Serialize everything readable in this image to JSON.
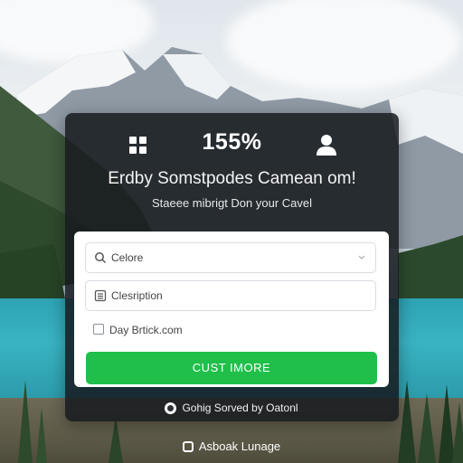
{
  "header": {
    "grid_icon": "grid-icon",
    "percent": "155%",
    "user_icon": "user-icon"
  },
  "card": {
    "headline": "Erdby Somstpodes Camean om!",
    "subline": "Staeee mibrigt Don your Cavel"
  },
  "form": {
    "field1": {
      "icon": "search-icon",
      "value": "Celore"
    },
    "field2": {
      "icon": "list-icon",
      "value": "Clesription"
    },
    "checkbox_label": "Day Brtick.com",
    "submit_label": "CUST IMORE"
  },
  "footer": {
    "text": "Gohig Sorved by Oatonl"
  },
  "bottom": {
    "text": "Asboak Lunage"
  },
  "colors": {
    "accent": "#1fbf4a",
    "card_bg": "#161a1e",
    "lake": "#2ea3b4"
  }
}
